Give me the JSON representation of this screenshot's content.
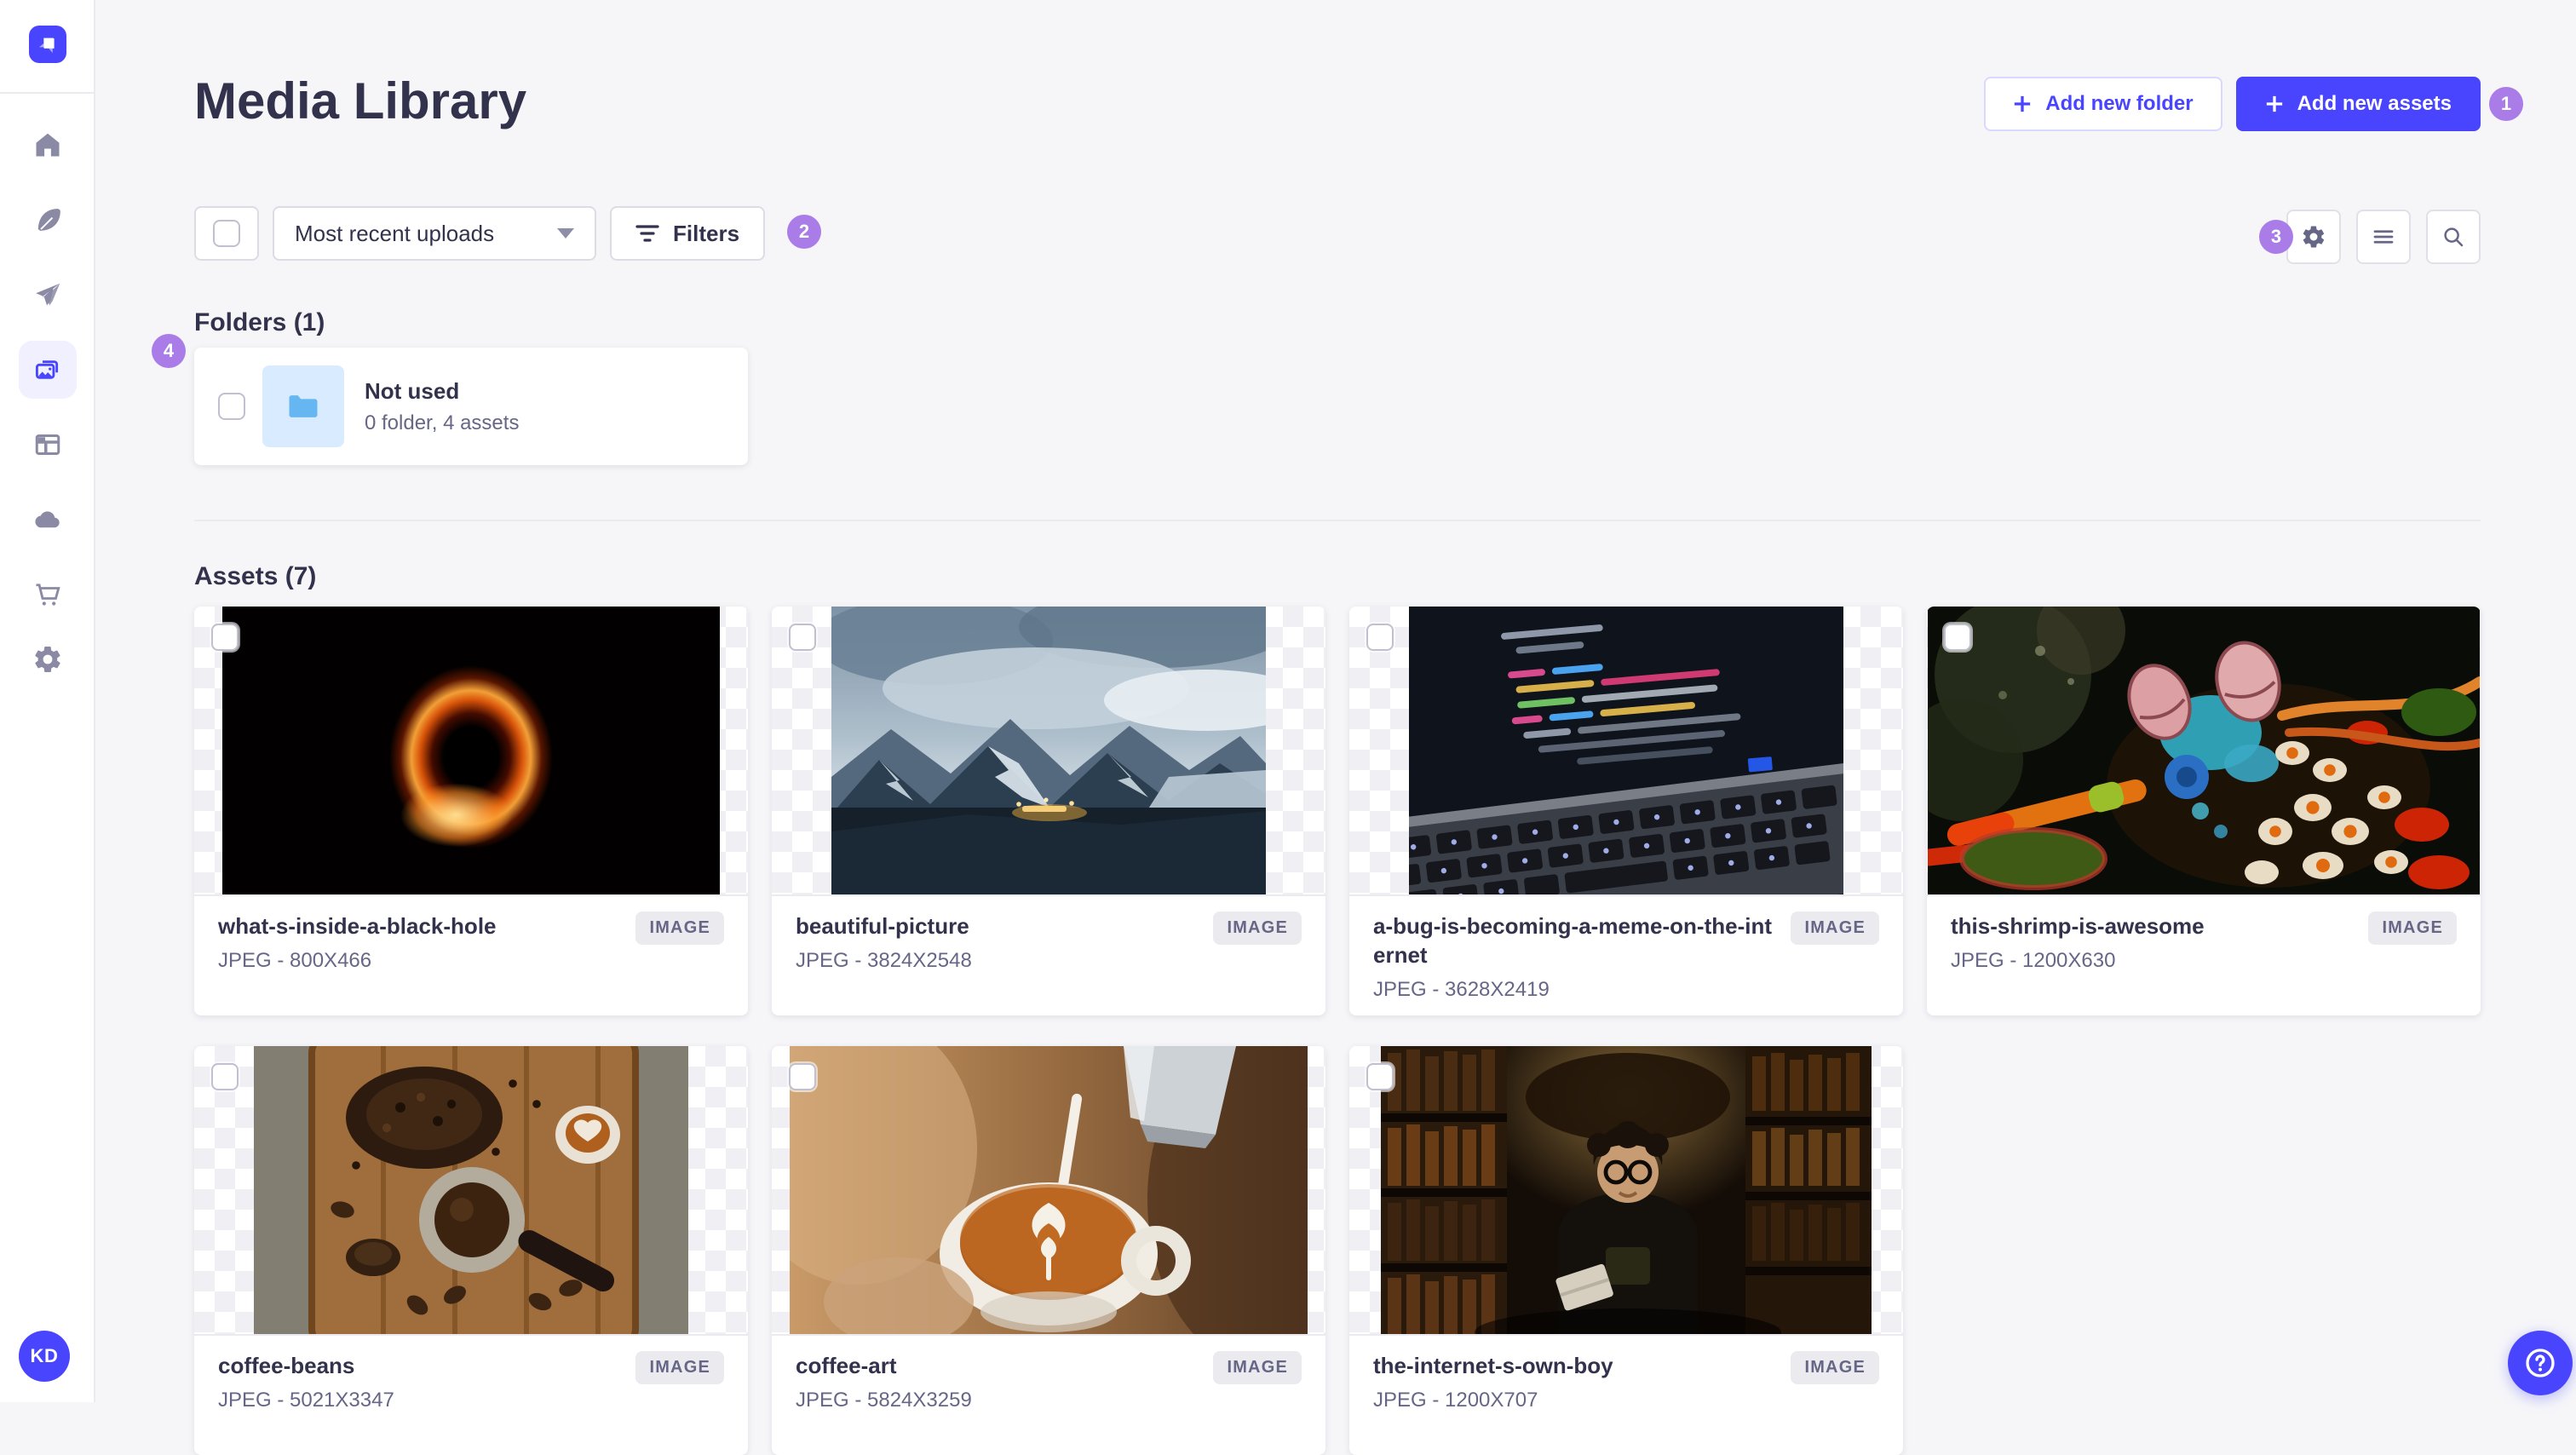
{
  "app": {
    "logo_alt": "Strapi",
    "avatar_initials": "KD",
    "colors": {
      "accent": "#4945ff",
      "annotation_badge": "#a97ce8",
      "folder_blue": "#66b7f1",
      "text_dark": "#32324d",
      "text_muted": "#666687",
      "page_bg": "#f6f6f9"
    }
  },
  "sidebar": {
    "items": [
      {
        "icon": "home-icon"
      },
      {
        "icon": "feather-icon"
      },
      {
        "icon": "paper-plane-icon"
      },
      {
        "icon": "media-images-icon",
        "active": true
      },
      {
        "icon": "browser-layout-icon"
      },
      {
        "icon": "cloud-icon"
      },
      {
        "icon": "cart-icon"
      },
      {
        "icon": "gear-icon"
      }
    ]
  },
  "header": {
    "title": "Media Library",
    "add_folder_label": "Add new folder",
    "add_assets_label": "Add new assets"
  },
  "toolbar": {
    "sort_value": "Most recent uploads",
    "filters_label": "Filters"
  },
  "annotations": {
    "n1": "1",
    "n2": "2",
    "n3": "3",
    "n4": "4"
  },
  "folders": {
    "heading": "Folders (1)",
    "items": [
      {
        "name": "Not used",
        "meta": "0 folder, 4 assets"
      }
    ]
  },
  "assets": {
    "heading": "Assets (7)",
    "type_badge": "IMAGE",
    "items": [
      {
        "name": "what-s-inside-a-black-hole",
        "meta": "JPEG - 800X466"
      },
      {
        "name": "beautiful-picture",
        "meta": "JPEG - 3824X2548"
      },
      {
        "name": "a-bug-is-becoming-a-meme-on-the-internet",
        "meta": "JPEG - 3628X2419"
      },
      {
        "name": "this-shrimp-is-awesome",
        "meta": "JPEG - 1200X630"
      },
      {
        "name": "coffee-beans",
        "meta": "JPEG - 5021X3347"
      },
      {
        "name": "coffee-art",
        "meta": "JPEG - 5824X3259"
      },
      {
        "name": "the-internet-s-own-boy",
        "meta": "JPEG - 1200X707"
      }
    ]
  }
}
